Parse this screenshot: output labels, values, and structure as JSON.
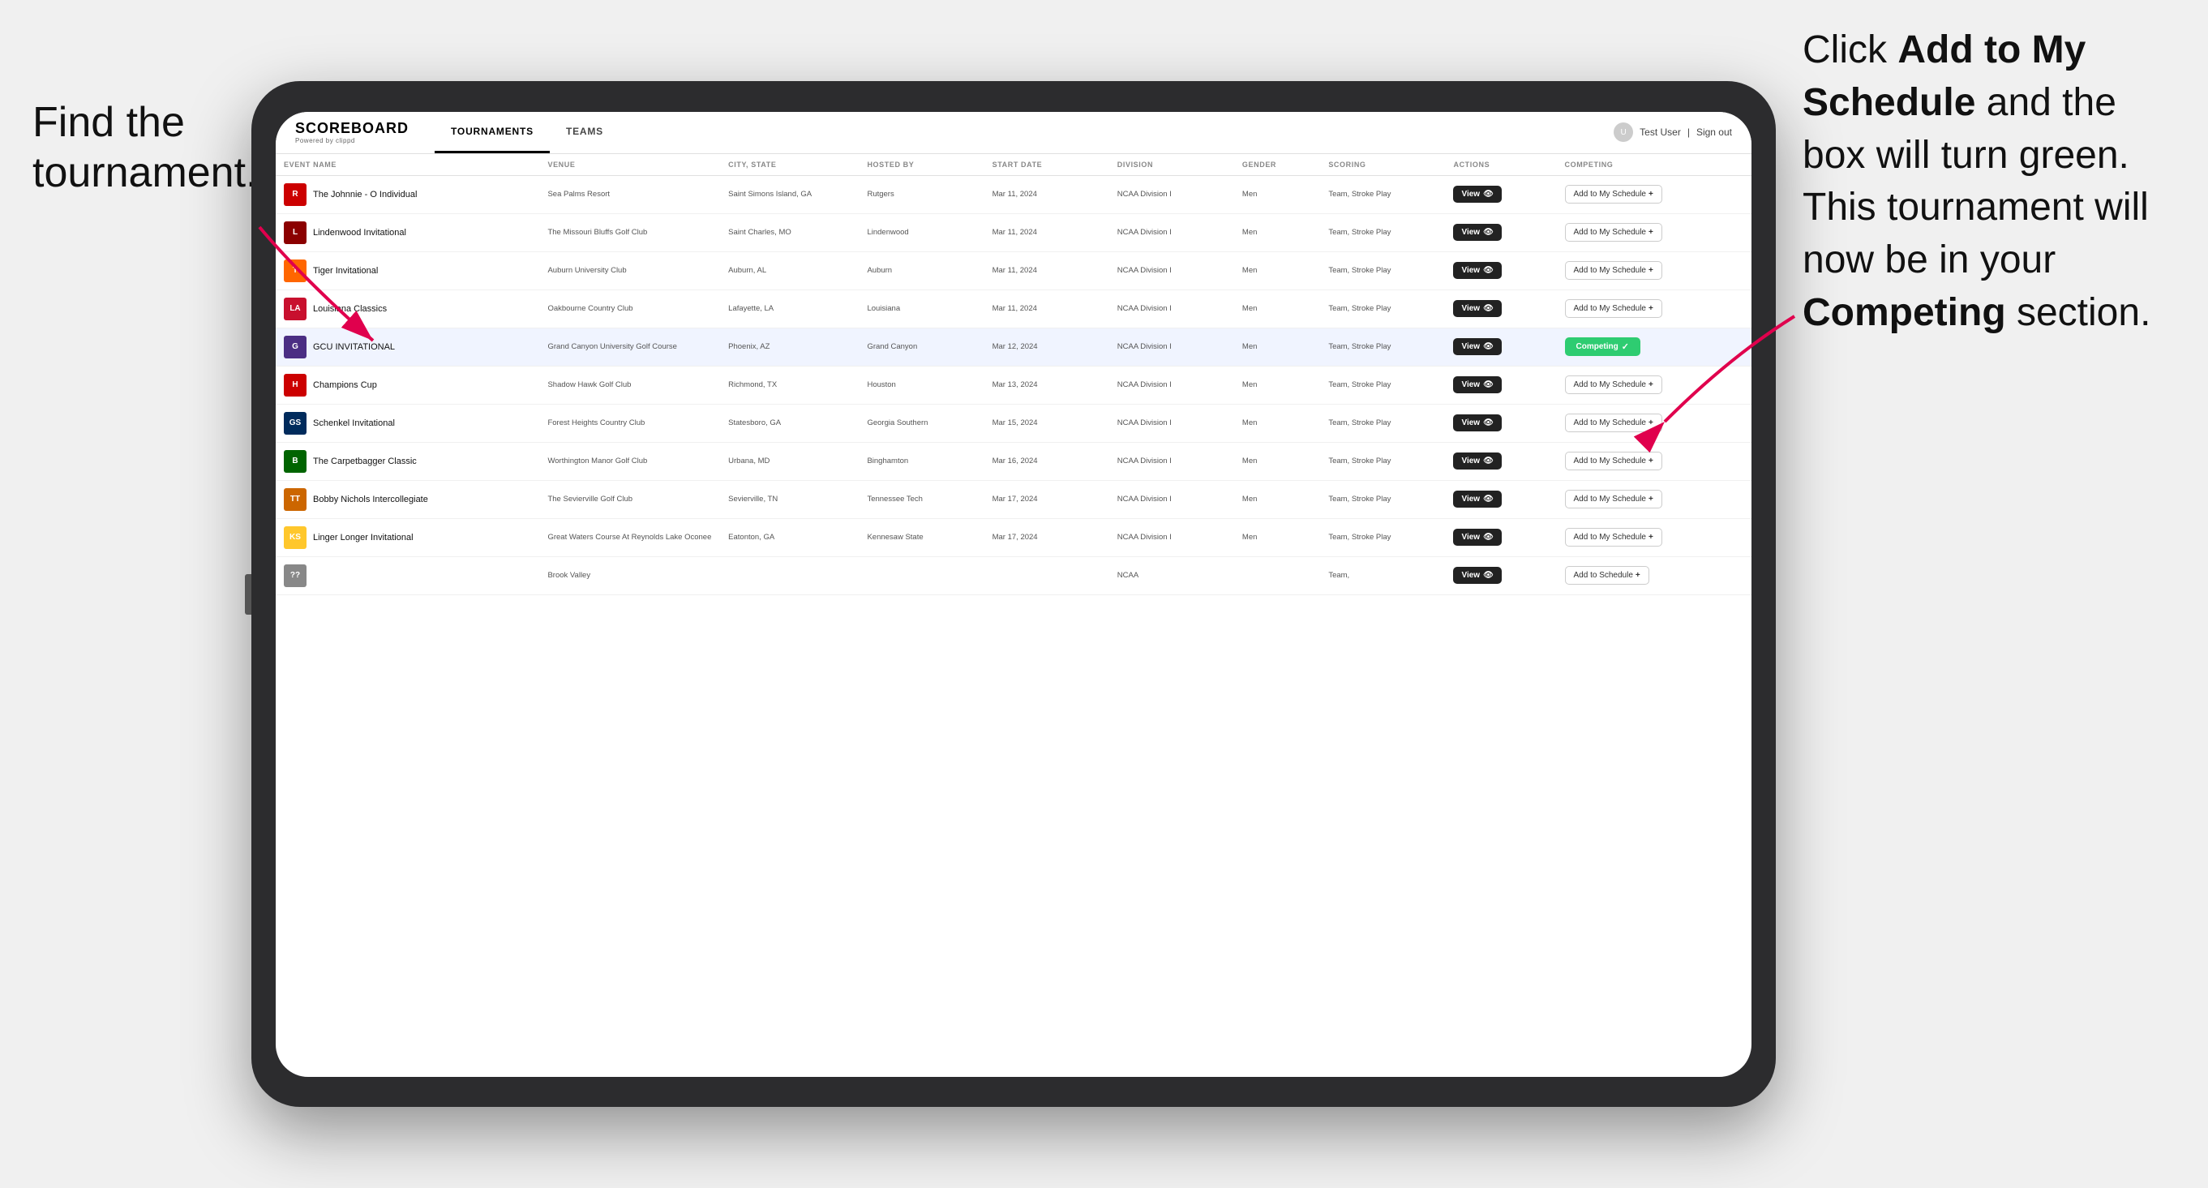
{
  "annotations": {
    "left": "Find the tournament.",
    "right_part1": "Click ",
    "right_bold1": "Add to My Schedule",
    "right_part2": " and the box will turn green. This tournament will now be in your ",
    "right_bold2": "Competing",
    "right_part3": " section."
  },
  "navbar": {
    "logo": "SCOREBOARD",
    "logo_sub": "Powered by clippd",
    "tabs": [
      "TOURNAMENTS",
      "TEAMS"
    ],
    "active_tab": "TOURNAMENTS",
    "user": "Test User",
    "signout": "Sign out"
  },
  "table": {
    "headers": [
      "EVENT NAME",
      "VENUE",
      "CITY, STATE",
      "HOSTED BY",
      "START DATE",
      "DIVISION",
      "GENDER",
      "SCORING",
      "ACTIONS",
      "COMPETING"
    ],
    "rows": [
      {
        "id": 1,
        "logo": "R",
        "logo_color": "#cc0000",
        "event": "The Johnnie - O Individual",
        "venue": "Sea Palms Resort",
        "city": "Saint Simons Island, GA",
        "hosted": "Rutgers",
        "date": "Mar 11, 2024",
        "division": "NCAA Division I",
        "gender": "Men",
        "scoring": "Team, Stroke Play",
        "action": "View",
        "competing": "Add to My Schedule",
        "is_competing": false,
        "highlighted": false
      },
      {
        "id": 2,
        "logo": "L",
        "logo_color": "#8b0000",
        "event": "Lindenwood Invitational",
        "venue": "The Missouri Bluffs Golf Club",
        "city": "Saint Charles, MO",
        "hosted": "Lindenwood",
        "date": "Mar 11, 2024",
        "division": "NCAA Division I",
        "gender": "Men",
        "scoring": "Team, Stroke Play",
        "action": "View",
        "competing": "Add to My Schedule",
        "is_competing": false,
        "highlighted": false
      },
      {
        "id": 3,
        "logo": "T",
        "logo_color": "#ff6600",
        "event": "Tiger Invitational",
        "venue": "Auburn University Club",
        "city": "Auburn, AL",
        "hosted": "Auburn",
        "date": "Mar 11, 2024",
        "division": "NCAA Division I",
        "gender": "Men",
        "scoring": "Team, Stroke Play",
        "action": "View",
        "competing": "Add to My Schedule",
        "is_competing": false,
        "highlighted": false
      },
      {
        "id": 4,
        "logo": "LA",
        "logo_color": "#c8102e",
        "event": "Louisiana Classics",
        "venue": "Oakbourne Country Club",
        "city": "Lafayette, LA",
        "hosted": "Louisiana",
        "date": "Mar 11, 2024",
        "division": "NCAA Division I",
        "gender": "Men",
        "scoring": "Team, Stroke Play",
        "action": "View",
        "competing": "Add to My Schedule",
        "is_competing": false,
        "highlighted": false
      },
      {
        "id": 5,
        "logo": "G",
        "logo_color": "#4b2e83",
        "event": "GCU INVITATIONAL",
        "venue": "Grand Canyon University Golf Course",
        "city": "Phoenix, AZ",
        "hosted": "Grand Canyon",
        "date": "Mar 12, 2024",
        "division": "NCAA Division I",
        "gender": "Men",
        "scoring": "Team, Stroke Play",
        "action": "View",
        "competing": "Competing",
        "is_competing": true,
        "highlighted": true
      },
      {
        "id": 6,
        "logo": "H",
        "logo_color": "#cc0000",
        "event": "Champions Cup",
        "venue": "Shadow Hawk Golf Club",
        "city": "Richmond, TX",
        "hosted": "Houston",
        "date": "Mar 13, 2024",
        "division": "NCAA Division I",
        "gender": "Men",
        "scoring": "Team, Stroke Play",
        "action": "View",
        "competing": "Add to My Schedule",
        "is_competing": false,
        "highlighted": false
      },
      {
        "id": 7,
        "logo": "GS",
        "logo_color": "#002B5C",
        "event": "Schenkel Invitational",
        "venue": "Forest Heights Country Club",
        "city": "Statesboro, GA",
        "hosted": "Georgia Southern",
        "date": "Mar 15, 2024",
        "division": "NCAA Division I",
        "gender": "Men",
        "scoring": "Team, Stroke Play",
        "action": "View",
        "competing": "Add to My Schedule",
        "is_competing": false,
        "highlighted": false
      },
      {
        "id": 8,
        "logo": "B",
        "logo_color": "#006400",
        "event": "The Carpetbagger Classic",
        "venue": "Worthington Manor Golf Club",
        "city": "Urbana, MD",
        "hosted": "Binghamton",
        "date": "Mar 16, 2024",
        "division": "NCAA Division I",
        "gender": "Men",
        "scoring": "Team, Stroke Play",
        "action": "View",
        "competing": "Add to My Schedule",
        "is_competing": false,
        "highlighted": false
      },
      {
        "id": 9,
        "logo": "TT",
        "logo_color": "#cc6600",
        "event": "Bobby Nichols Intercollegiate",
        "venue": "The Sevierville Golf Club",
        "city": "Sevierville, TN",
        "hosted": "Tennessee Tech",
        "date": "Mar 17, 2024",
        "division": "NCAA Division I",
        "gender": "Men",
        "scoring": "Team, Stroke Play",
        "action": "View",
        "competing": "Add to My Schedule",
        "is_competing": false,
        "highlighted": false
      },
      {
        "id": 10,
        "logo": "KS",
        "logo_color": "#ffc72c",
        "event": "Linger Longer Invitational",
        "venue": "Great Waters Course At Reynolds Lake Oconee",
        "city": "Eatonton, GA",
        "hosted": "Kennesaw State",
        "date": "Mar 17, 2024",
        "division": "NCAA Division I",
        "gender": "Men",
        "scoring": "Team, Stroke Play",
        "action": "View",
        "competing": "Add to My Schedule",
        "is_competing": false,
        "highlighted": false
      },
      {
        "id": 11,
        "logo": "??",
        "logo_color": "#888",
        "event": "",
        "venue": "Brook Valley",
        "city": "",
        "hosted": "",
        "date": "",
        "division": "NCAA",
        "gender": "",
        "scoring": "Team,",
        "action": "View",
        "competing": "Add to Schedule",
        "is_competing": false,
        "highlighted": false
      }
    ]
  }
}
